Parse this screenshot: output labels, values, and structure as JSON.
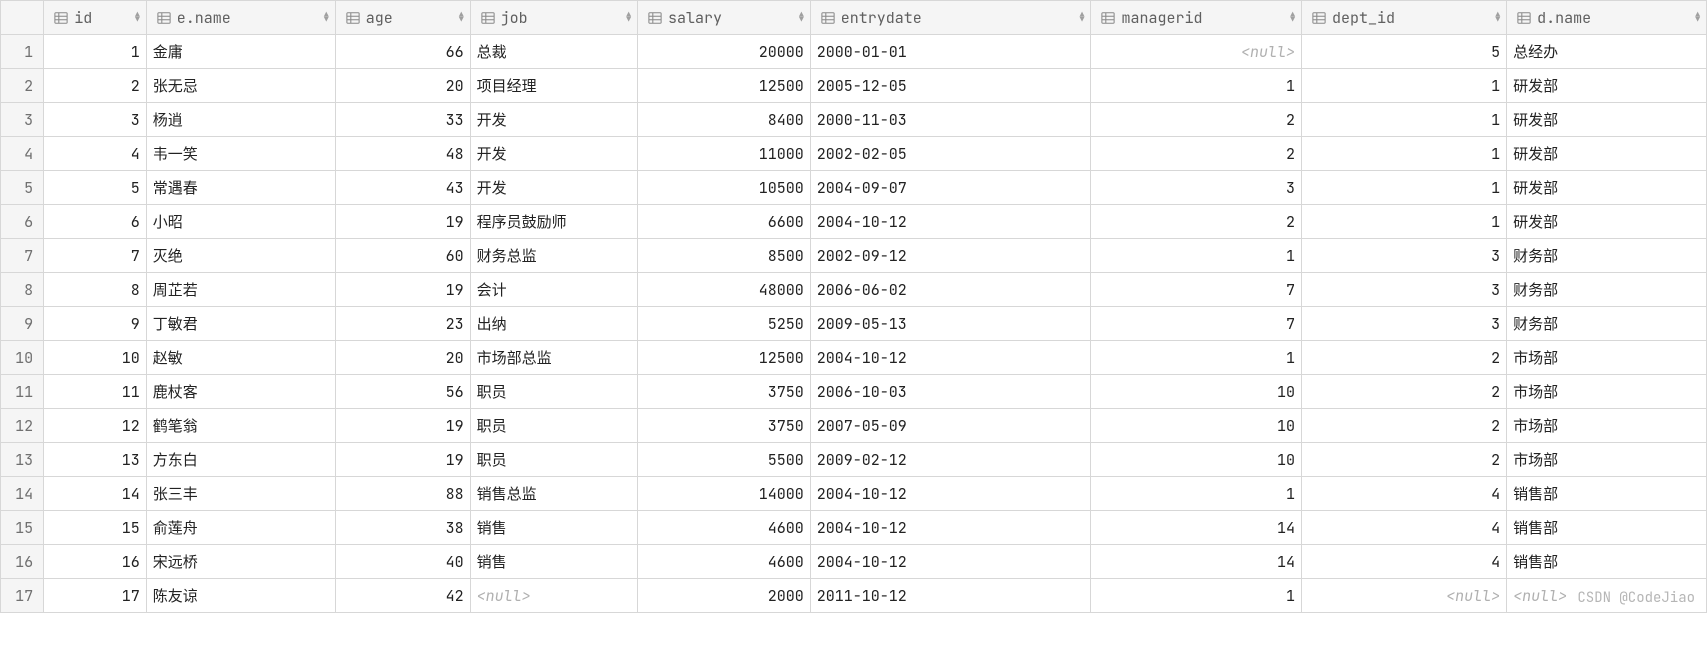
{
  "columns": [
    {
      "key": "id",
      "label": "id",
      "align": "num",
      "cls": "col-id"
    },
    {
      "key": "e_name",
      "label": "e.name",
      "align": "txt",
      "cls": "col-ename"
    },
    {
      "key": "age",
      "label": "age",
      "align": "num",
      "cls": "col-age"
    },
    {
      "key": "job",
      "label": "job",
      "align": "txt",
      "cls": "col-job"
    },
    {
      "key": "salary",
      "label": "salary",
      "align": "num",
      "cls": "col-salary"
    },
    {
      "key": "entrydate",
      "label": "entrydate",
      "align": "txt",
      "cls": "col-entrydate"
    },
    {
      "key": "managerid",
      "label": "managerid",
      "align": "num",
      "cls": "col-managerid"
    },
    {
      "key": "dept_id",
      "label": "dept_id",
      "align": "num",
      "cls": "col-deptid"
    },
    {
      "key": "d_name",
      "label": "d.name",
      "align": "txt",
      "cls": "col-dname"
    }
  ],
  "rows": [
    {
      "n": "1",
      "id": "1",
      "e_name": "金庸",
      "age": "66",
      "job": "总裁",
      "salary": "20000",
      "entrydate": "2000-01-01",
      "managerid": null,
      "dept_id": "5",
      "d_name": "总经办"
    },
    {
      "n": "2",
      "id": "2",
      "e_name": "张无忌",
      "age": "20",
      "job": "项目经理",
      "salary": "12500",
      "entrydate": "2005-12-05",
      "managerid": "1",
      "dept_id": "1",
      "d_name": "研发部"
    },
    {
      "n": "3",
      "id": "3",
      "e_name": "杨逍",
      "age": "33",
      "job": "开发",
      "salary": "8400",
      "entrydate": "2000-11-03",
      "managerid": "2",
      "dept_id": "1",
      "d_name": "研发部"
    },
    {
      "n": "4",
      "id": "4",
      "e_name": "韦一笑",
      "age": "48",
      "job": "开发",
      "salary": "11000",
      "entrydate": "2002-02-05",
      "managerid": "2",
      "dept_id": "1",
      "d_name": "研发部"
    },
    {
      "n": "5",
      "id": "5",
      "e_name": "常遇春",
      "age": "43",
      "job": "开发",
      "salary": "10500",
      "entrydate": "2004-09-07",
      "managerid": "3",
      "dept_id": "1",
      "d_name": "研发部"
    },
    {
      "n": "6",
      "id": "6",
      "e_name": "小昭",
      "age": "19",
      "job": "程序员鼓励师",
      "salary": "6600",
      "entrydate": "2004-10-12",
      "managerid": "2",
      "dept_id": "1",
      "d_name": "研发部"
    },
    {
      "n": "7",
      "id": "7",
      "e_name": "灭绝",
      "age": "60",
      "job": "财务总监",
      "salary": "8500",
      "entrydate": "2002-09-12",
      "managerid": "1",
      "dept_id": "3",
      "d_name": "财务部"
    },
    {
      "n": "8",
      "id": "8",
      "e_name": "周芷若",
      "age": "19",
      "job": "会计",
      "salary": "48000",
      "entrydate": "2006-06-02",
      "managerid": "7",
      "dept_id": "3",
      "d_name": "财务部"
    },
    {
      "n": "9",
      "id": "9",
      "e_name": "丁敏君",
      "age": "23",
      "job": "出纳",
      "salary": "5250",
      "entrydate": "2009-05-13",
      "managerid": "7",
      "dept_id": "3",
      "d_name": "财务部"
    },
    {
      "n": "10",
      "id": "10",
      "e_name": "赵敏",
      "age": "20",
      "job": "市场部总监",
      "salary": "12500",
      "entrydate": "2004-10-12",
      "managerid": "1",
      "dept_id": "2",
      "d_name": "市场部"
    },
    {
      "n": "11",
      "id": "11",
      "e_name": "鹿杖客",
      "age": "56",
      "job": "职员",
      "salary": "3750",
      "entrydate": "2006-10-03",
      "managerid": "10",
      "dept_id": "2",
      "d_name": "市场部"
    },
    {
      "n": "12",
      "id": "12",
      "e_name": "鹤笔翁",
      "age": "19",
      "job": "职员",
      "salary": "3750",
      "entrydate": "2007-05-09",
      "managerid": "10",
      "dept_id": "2",
      "d_name": "市场部"
    },
    {
      "n": "13",
      "id": "13",
      "e_name": "方东白",
      "age": "19",
      "job": "职员",
      "salary": "5500",
      "entrydate": "2009-02-12",
      "managerid": "10",
      "dept_id": "2",
      "d_name": "市场部"
    },
    {
      "n": "14",
      "id": "14",
      "e_name": "张三丰",
      "age": "88",
      "job": "销售总监",
      "salary": "14000",
      "entrydate": "2004-10-12",
      "managerid": "1",
      "dept_id": "4",
      "d_name": "销售部"
    },
    {
      "n": "15",
      "id": "15",
      "e_name": "俞莲舟",
      "age": "38",
      "job": "销售",
      "salary": "4600",
      "entrydate": "2004-10-12",
      "managerid": "14",
      "dept_id": "4",
      "d_name": "销售部"
    },
    {
      "n": "16",
      "id": "16",
      "e_name": "宋远桥",
      "age": "40",
      "job": "销售",
      "salary": "4600",
      "entrydate": "2004-10-12",
      "managerid": "14",
      "dept_id": "4",
      "d_name": "销售部"
    },
    {
      "n": "17",
      "id": "17",
      "e_name": "陈友谅",
      "age": "42",
      "job": null,
      "salary": "2000",
      "entrydate": "2011-10-12",
      "managerid": "1",
      "dept_id": null,
      "d_name": null
    }
  ],
  "null_text": "<null>",
  "watermark": "CSDN @CodeJiao"
}
